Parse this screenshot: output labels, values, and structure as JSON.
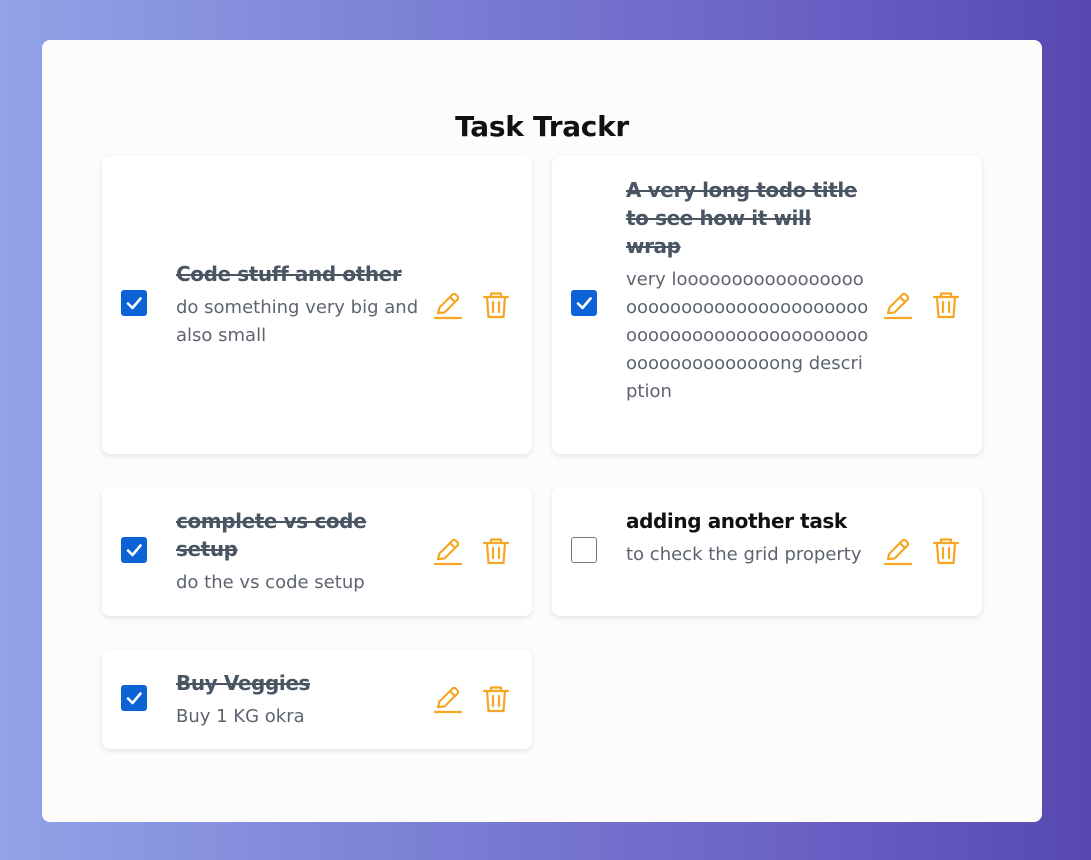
{
  "app": {
    "title": "Task Trackr"
  },
  "colors": {
    "accent": "#f5a623",
    "checkbox": "#0b63d6"
  },
  "tasks": [
    {
      "title": "Code stuff and other",
      "description": "do something very big and also small",
      "completed": true
    },
    {
      "title": "A very long todo title to see how it will wrap",
      "description": "very looooooooooooooooooooooooooooooooooooooooooooooooooooooooooooooooooooooooooong description",
      "completed": true
    },
    {
      "title": "complete vs code setup",
      "description": "do the vs code setup",
      "completed": true
    },
    {
      "title": "adding another task",
      "description": "to check the grid property",
      "completed": false
    },
    {
      "title": "Buy Veggies",
      "description": "Buy 1 KG okra",
      "completed": true
    }
  ]
}
